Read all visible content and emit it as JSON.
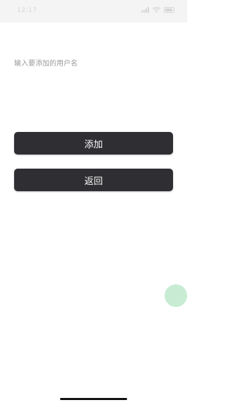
{
  "status_bar": {
    "time": "12:17"
  },
  "form": {
    "username_placeholder": "输入要添加的用户名",
    "username_value": ""
  },
  "buttons": {
    "add_label": "添加",
    "back_label": "返回"
  },
  "colors": {
    "button_bg": "#2f2f33",
    "button_text": "#ffffff",
    "placeholder": "#9b9b9f",
    "floating_bubble": "#c7ecd3"
  }
}
